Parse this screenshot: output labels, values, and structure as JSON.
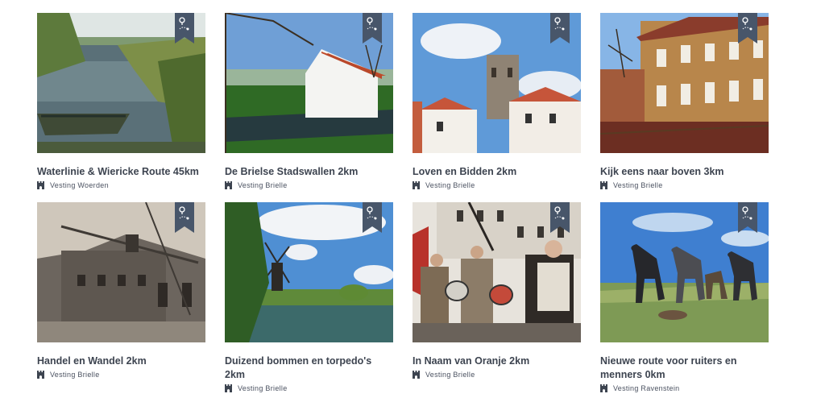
{
  "routes": [
    {
      "title": "Waterlinie & Wiericke Route 45km",
      "location": "Vesting Woerden",
      "scene": "pond-with-boat"
    },
    {
      "title": "De Brielse Stadswallen 2km",
      "location": "Vesting Brielle",
      "scene": "white-house"
    },
    {
      "title": "Loven en Bidden 2km",
      "location": "Vesting Brielle",
      "scene": "church-tower"
    },
    {
      "title": "Kijk eens naar boven 3km",
      "location": "Vesting Brielle",
      "scene": "brick-building"
    },
    {
      "title": "Handel en Wandel 2km",
      "location": "Vesting Brielle",
      "scene": "sepia-warehouse"
    },
    {
      "title": "Duizend bommen en torpedo's 2km",
      "location": "Vesting Brielle",
      "scene": "windmill-canal"
    },
    {
      "title": "In Naam van Oranje 2km",
      "location": "Vesting Brielle",
      "scene": "drummers-parade"
    },
    {
      "title": "Nieuwe route voor ruiters en menners 0km",
      "location": "Vesting Ravenstein",
      "scene": "horses-field"
    }
  ],
  "colors": {
    "title": "#3d4450",
    "ribbon": "#48566a"
  },
  "icons": {
    "ribbon": "map-route-icon",
    "location": "castle-tower-icon"
  }
}
